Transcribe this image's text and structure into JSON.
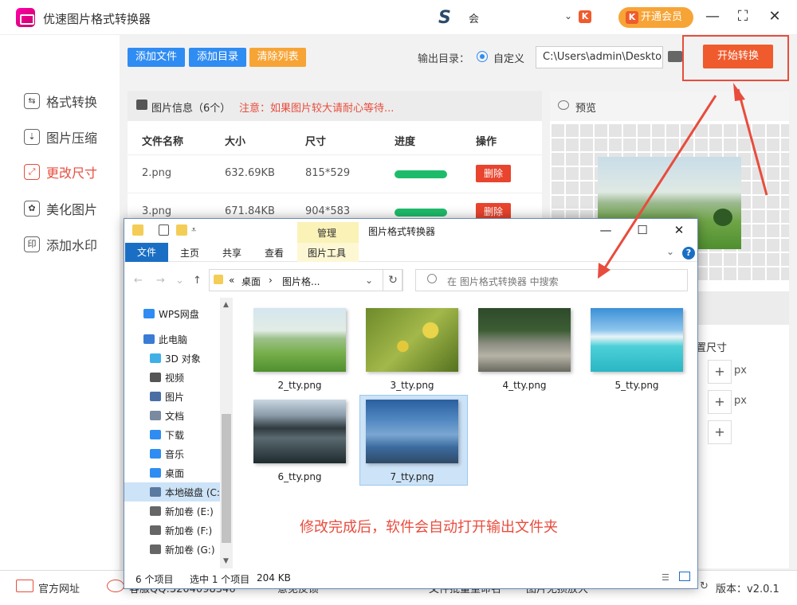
{
  "app": {
    "title": "优速图片格式转换器",
    "account_label": "会",
    "vip_label": "开通会员",
    "vip_k": "K"
  },
  "sidebar": {
    "items": [
      {
        "label": "格式转换",
        "icon": "format-convert-icon",
        "glyph": "⇆"
      },
      {
        "label": "图片压缩",
        "icon": "compress-icon",
        "glyph": "⇣"
      },
      {
        "label": "更改尺寸",
        "icon": "resize-icon",
        "glyph": "⤢"
      },
      {
        "label": "美化图片",
        "icon": "beautify-icon",
        "glyph": "✿"
      },
      {
        "label": "添加水印",
        "icon": "watermark-icon",
        "glyph": "印"
      }
    ],
    "active_index": 2
  },
  "toolbar": {
    "add_file": "添加文件",
    "add_dir": "添加目录",
    "clear_list": "清除列表",
    "output_label": "输出目录：",
    "custom_label": "自定义",
    "output_path": "C:\\Users\\admin\\Desktop",
    "start": "开始转换"
  },
  "file_panel": {
    "title": "图片信息（6个）",
    "notice": "注意：如果图片较大请耐心等待...",
    "columns": [
      "文件名称",
      "大小",
      "尺寸",
      "进度",
      "操作"
    ],
    "rows": [
      {
        "name": "2.png",
        "size": "632.69KB",
        "dims": "815*529",
        "progress": 1.0,
        "action": "删除"
      },
      {
        "name": "3.png",
        "size": "671.84KB",
        "dims": "904*583",
        "progress": 1.0,
        "action": "删除"
      }
    ]
  },
  "preview": {
    "title": "预览",
    "setting_label": "设置尺寸",
    "unit": "px",
    "plus": "+"
  },
  "explorer": {
    "title": "图片格式转换器",
    "manage_tab": "管理",
    "picture_tools": "图片工具",
    "ribbon_tabs": [
      "文件",
      "主页",
      "共享",
      "查看"
    ],
    "help": "?",
    "breadcrumb": [
      "«",
      "桌面",
      "›",
      "图片格..."
    ],
    "search_placeholder": "在 图片格式转换器 中搜索",
    "tree": [
      {
        "label": "WPS网盘",
        "icon": "cloud-icon",
        "color": "#2f8cf2"
      },
      {
        "label": "此电脑",
        "icon": "computer-icon",
        "color": "#3a7bd5"
      },
      {
        "label": "3D 对象",
        "icon": "3d-objects-icon",
        "color": "#3fb0e6"
      },
      {
        "label": "视频",
        "icon": "video-icon",
        "color": "#555555"
      },
      {
        "label": "图片",
        "icon": "pictures-icon",
        "color": "#4a6fa5"
      },
      {
        "label": "文档",
        "icon": "documents-icon",
        "color": "#7a8aa0"
      },
      {
        "label": "下载",
        "icon": "downloads-icon",
        "color": "#2f8cf2"
      },
      {
        "label": "音乐",
        "icon": "music-icon",
        "color": "#2f8cf2"
      },
      {
        "label": "桌面",
        "icon": "desktop-icon",
        "color": "#2f8cf2"
      },
      {
        "label": "本地磁盘 (C:",
        "icon": "local-disk-icon",
        "color": "#5a7aa0"
      },
      {
        "label": "新加卷 (E:)",
        "icon": "drive-icon",
        "color": "#666666"
      },
      {
        "label": "新加卷 (F:)",
        "icon": "drive-icon",
        "color": "#666666"
      },
      {
        "label": "新加卷 (G:)",
        "icon": "drive-icon",
        "color": "#666666"
      }
    ],
    "files": [
      {
        "name": "2_tty.png",
        "scene": "green-meadow-hills"
      },
      {
        "name": "3_tty.png",
        "scene": "yellow-flowers"
      },
      {
        "name": "4_tty.png",
        "scene": "rocky-stream-forest"
      },
      {
        "name": "5_tty.png",
        "scene": "tropical-beach"
      },
      {
        "name": "6_tty.png",
        "scene": "mountain-lake-reflection"
      },
      {
        "name": "7_tty.png",
        "scene": "blue-mountain-range"
      }
    ],
    "selected_index": 5,
    "note": "修改完成后，软件会自动打开输出文件夹",
    "status": {
      "count": "6 个项目",
      "selected": "选中 1 个项目",
      "size": "204 KB"
    }
  },
  "footer": {
    "site": "官方网址",
    "qq": "客服QQ:3204098346",
    "feedback": "意见反馈",
    "batch": "文件批量重命名",
    "enlarge": "图片无损放大",
    "version": "版本：v2.0.1"
  },
  "colors": {
    "accent_red": "#e84c3d",
    "blue": "#2f8cf2",
    "orange": "#f7a436",
    "progress_green": "#1ebc6a"
  }
}
